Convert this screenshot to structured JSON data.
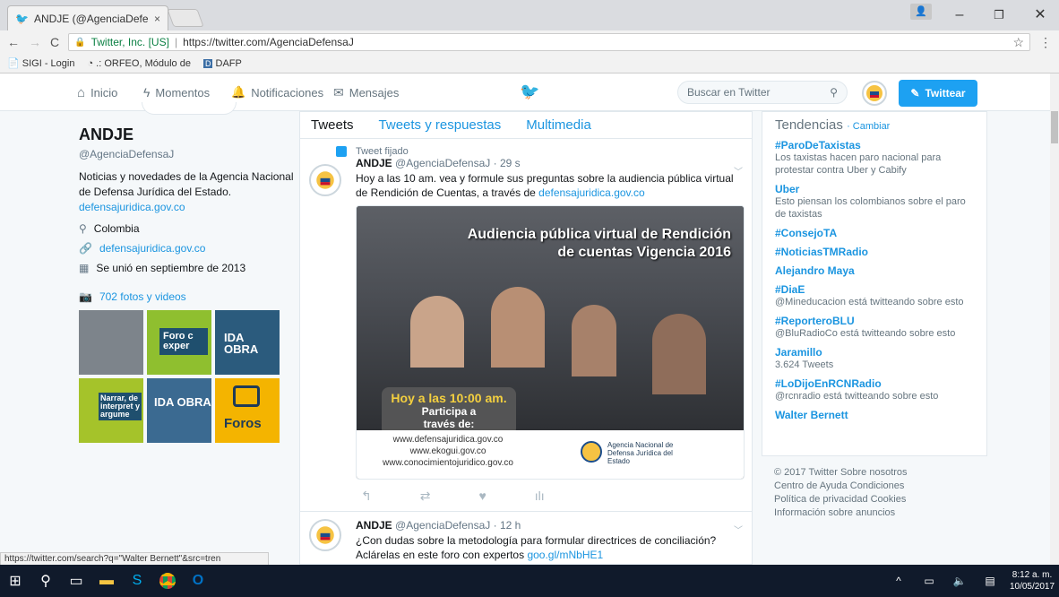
{
  "browser": {
    "tab_title": "ANDJE (@AgenciaDefens",
    "tab_close": "×",
    "url_org": "Twitter, Inc. [US]",
    "url": "https://twitter.com/AgenciaDefensaJ",
    "bookmarks": [
      "SIGI - Login",
      ".: ORFEO, Módulo de",
      "DAFP"
    ],
    "status_url": "https://twitter.com/search?q=\"Walter Bernett\"&src=tren"
  },
  "nav": {
    "home": "Inicio",
    "moments": "Momentos",
    "notifications": "Notificaciones",
    "messages": "Mensajes",
    "search_placeholder": "Buscar en Twitter",
    "tweet_button": "Twittear"
  },
  "profile": {
    "name": "ANDJE",
    "handle": "@AgenciaDefensaJ",
    "bio": "Noticias y novedades de la Agencia Nacional de Defensa Jurídica del Estado.",
    "bio_link": "defensajuridica.gov.co",
    "location": "Colombia",
    "website": "defensajuridica.gov.co",
    "joined": "Se unió en septiembre de 2013",
    "photos": "702 fotos y videos",
    "thumbs": [
      {
        "text": ""
      },
      {
        "text": "Foro c exper"
      },
      {
        "text": "IDA OBRA"
      },
      {
        "text": "Narrar, de interpret y argume"
      },
      {
        "text": "IDA OBRA"
      },
      {
        "text": "Foros"
      }
    ]
  },
  "timeline": {
    "tabs": [
      "Tweets",
      "Tweets y respuestas",
      "Multimedia"
    ],
    "pinned_label": "Tweet fijado",
    "tweets": [
      {
        "name": "ANDJE",
        "handle": "@AgenciaDefensaJ",
        "time": "· 29 s",
        "text": "Hoy a las 10 am. vea y formule sus preguntas sobre la audiencia pública virtual de Rendición de Cuentas, a través de",
        "link": "defensajuridica.gov.co",
        "image": {
          "title_line1": "Audiencia pública virtual de Rendición",
          "title_line2": "de cuentas Vigencia 2016",
          "time_line": "Hoy a las 10:00 am.",
          "cta_line1": "Participa a",
          "cta_line2": "través de:",
          "urls": [
            "www.defensajuridica.gov.co",
            "www.ekogui.gov.co",
            "www.conocimientojuridico.gov.co"
          ],
          "agency": "Agencia Nacional de Defensa Jurídica del Estado"
        }
      },
      {
        "name": "ANDJE",
        "handle": "@AgenciaDefensaJ",
        "time": "· 12 h",
        "text": "¿Con dudas sobre la metodología para formular directrices de conciliación? Aclárelas en este foro con expertos",
        "link": "goo.gl/mNbHE1"
      }
    ]
  },
  "trends": {
    "title": "Tendencias",
    "change": "· Cambiar",
    "items": [
      {
        "name": "#ParoDeTaxistas",
        "desc": "Los taxistas hacen paro nacional para protestar contra Uber y Cabify"
      },
      {
        "name": "Uber",
        "desc": "Esto piensan los colombianos sobre el paro de taxistas"
      },
      {
        "name": "#ConsejoTA",
        "desc": ""
      },
      {
        "name": "#NoticiasTMRadio",
        "desc": ""
      },
      {
        "name": "Alejandro Maya",
        "desc": ""
      },
      {
        "name": "#DiaE",
        "desc": "@Mineducacion está twitteando sobre esto"
      },
      {
        "name": "#ReporteroBLU",
        "desc": "@BluRadioCo está twitteando sobre esto"
      },
      {
        "name": "Jaramillo",
        "desc": "3.624 Tweets"
      },
      {
        "name": "#LoDijoEnRCNRadio",
        "desc": "@rcnradio está twitteando sobre esto"
      },
      {
        "name": "Walter Bernett",
        "desc": ""
      }
    ]
  },
  "footer": {
    "line1": "© 2017 Twitter  Sobre nosotros",
    "line2": "Centro de Ayuda  Condiciones",
    "line3": "Política de privacidad  Cookies",
    "line4": "Información sobre anuncios"
  },
  "taskbar": {
    "time": "8:12 a. m.",
    "date": "10/05/2017"
  },
  "colors": {
    "accent": "#1da1f2",
    "link": "#1b95e0",
    "taskbar": "#101a2b"
  }
}
